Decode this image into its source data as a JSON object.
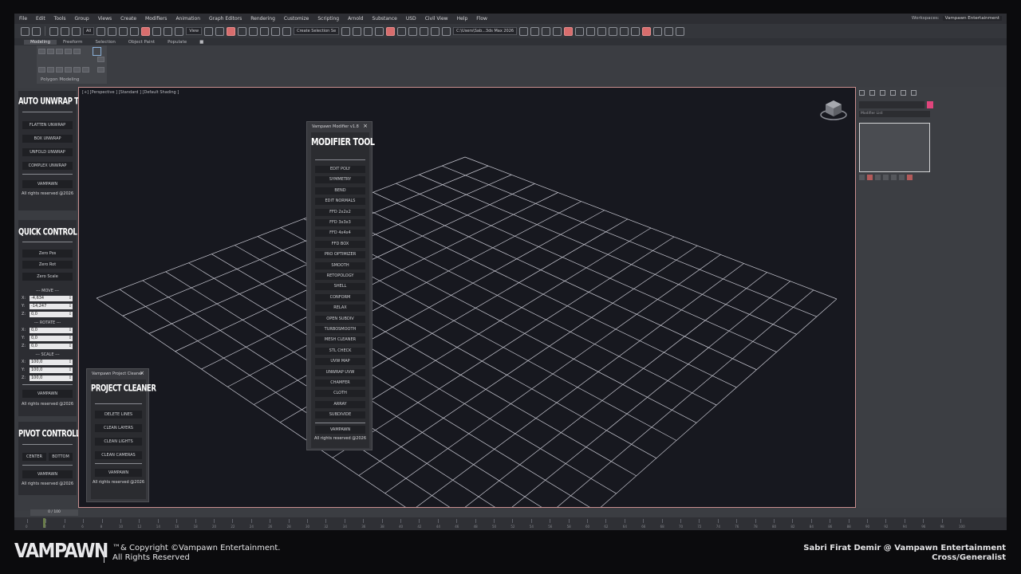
{
  "menu": [
    "File",
    "Edit",
    "Tools",
    "Group",
    "Views",
    "Create",
    "Modifiers",
    "Animation",
    "Graph Editors",
    "Rendering",
    "Customize",
    "Scripting",
    "Arnold",
    "Substance",
    "USD",
    "Civil View",
    "Help",
    "Flow"
  ],
  "workspace": {
    "label": "Workspaces:",
    "value": "Vampawn Entertainment"
  },
  "toolbar": {
    "filter": "All",
    "ref_coord": "View",
    "selection_set": "Create Selection Se",
    "path": "C:\\Users\\Sab...3ds Max 2026"
  },
  "ribbon": {
    "tabs": [
      "Modeling",
      "Freeform",
      "Selection",
      "Object Paint",
      "Populate"
    ],
    "active": "Modeling",
    "panel_label": "Polygon Modeling"
  },
  "viewport": {
    "label": "[+] [Perspective ] [Standard ] [Default Shading ]"
  },
  "auto_unwrap": {
    "title": "AUTO UNWRAP TOOL",
    "buttons": [
      "FLATTEN UNWRAP",
      "BOX UNWRAP",
      "UNFOLD UNWRAP",
      "COMPLEX UNWRAP"
    ],
    "brand": "VAMPAWN",
    "rights": "All rights reserved @2026"
  },
  "quick_control": {
    "title": "QUICK CONTROL TOOL",
    "buttons": [
      "Zero Pos",
      "Zero Rot",
      "Zero Scale"
    ],
    "move": {
      "label": "--- MOVE ---",
      "x": "-4,634",
      "y": "-14,247",
      "z": "0,0"
    },
    "rotate": {
      "label": "--- ROTATE ---",
      "x": "0,0",
      "y": "0,0",
      "z": "0,0"
    },
    "scale": {
      "label": "--- SCALE ---",
      "x": "100,0",
      "y": "100,0",
      "z": "100,0"
    },
    "axes": [
      "X:",
      "Y:",
      "Z:"
    ],
    "brand": "VAMPAWN",
    "rights": "All rights reserved @2026"
  },
  "pivot_controller": {
    "title": "PIVOT CONTROLLER",
    "buttons": [
      "CENTER",
      "BOTTOM"
    ],
    "brand": "VAMPAWN",
    "rights": "All rights reserved @2026"
  },
  "modifier_tool": {
    "window_title": "Vampawn Modifier v1.8",
    "title": "MODIFIER TOOL",
    "buttons": [
      "EDIT POLY",
      "SYMMETRY",
      "BEND",
      "EDIT NORMALS",
      "FFD 2x2x2",
      "FFD 3x3x3",
      "FFD 4x4x4",
      "FFD BOX",
      "PRO OPTIMIZER",
      "SMOOTH",
      "RETOPOLOGY",
      "SHELL",
      "CONFORM",
      "RELAX",
      "OPEN SUBDIV",
      "TURBOSMOOTH",
      "MESH CLEANER",
      "STL CHECK",
      "UVW MAP",
      "UNWRAP UVW",
      "CHAMFER",
      "CLOTH",
      "ARRAY",
      "SUBDIVIDE"
    ],
    "brand": "VAMPAWN",
    "rights": "All rights reserved @2026"
  },
  "project_cleaner": {
    "window_title": "Vampawn Project Cleaner",
    "title": "PROJECT CLEANER",
    "buttons": [
      "DELETE LINES",
      "CLEAN LAYERS",
      "CLEAN LIGHTS",
      "CLEAN CAMERAS"
    ],
    "brand": "VAMPAWN",
    "rights": "All rights reserved @2026"
  },
  "command_panel": {
    "modifier_list": "Modifier List"
  },
  "timeline": {
    "frame": "0 / 100",
    "ticks": [
      "0",
      "2",
      "4",
      "6",
      "8",
      "10",
      "12",
      "14",
      "16",
      "18",
      "20",
      "22",
      "24",
      "26",
      "28",
      "30",
      "32",
      "34",
      "36",
      "38",
      "40",
      "42",
      "44",
      "46",
      "48",
      "50",
      "52",
      "54",
      "56",
      "58",
      "60",
      "62",
      "64",
      "66",
      "68",
      "70",
      "72",
      "74",
      "76",
      "78",
      "80",
      "82",
      "84",
      "86",
      "88",
      "90",
      "92",
      "94",
      "96",
      "98",
      "100"
    ]
  },
  "footer": {
    "logo": "VAMPAWN",
    "copyright_line1": "™& Copyright ©Vampawn Entertainment.",
    "copyright_line2": "All Rights Reserved",
    "credit_line1": "Sabri Firat Demir @ Vampawn Entertainment",
    "credit_line2": "Cross/Generalist"
  },
  "colors": {
    "accent_pink": "#e0457c",
    "viewport_border": "#c98f8f",
    "grid_line": "#c8c8d2"
  }
}
